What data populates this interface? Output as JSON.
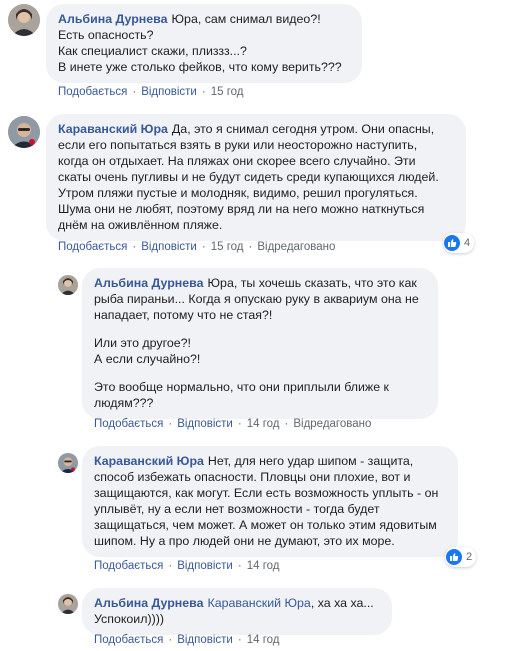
{
  "comments": [
    {
      "author": "Альбина Дурнева",
      "lines": [
        "Юра, сам снимал видео?!",
        "Есть опасность?",
        "Как специалист скажи, плиззз...?",
        "В инете уже столько фейков, что кому верить???"
      ],
      "actions": {
        "like": "Подобається",
        "reply": "Відповісти",
        "time": "15 год"
      }
    },
    {
      "author": "Караванский Юра",
      "lines": [
        "Да, это я снимал сегодня утром. Они опасны,",
        "если его попытаться взять в руки или неосторожно наступить,",
        "когда он отдыхает. На пляжах они скорее всего случайно. Эти",
        "скаты очень пугливы и не будут сидеть среди купающихся людей.",
        "Утром пляжи пустые и молодняк, видимо, решил прогуляться.",
        "Шума они не любят, поэтому вряд ли на него можно наткнуться",
        "днём на оживлённом пляже."
      ],
      "actions": {
        "like": "Подобається",
        "reply": "Відповісти",
        "time": "15 год",
        "edited": "Відредаговано"
      },
      "reactions": {
        "icon": "like-icon",
        "count": "4"
      }
    },
    {
      "author": "Альбина Дурнева",
      "lines": [
        "Юра, ты хочешь сказать, что это как",
        "рыба пираньи... Когда я опускаю руку в аквариум она не",
        "нападает, потому что не стая?!"
      ],
      "lines2": [
        "Или это другое?!",
        "А если случайно?!"
      ],
      "lines3": [
        "Это вообще нормально, что они приплыли ближе к",
        "людям???"
      ],
      "actions": {
        "like": "Подобається",
        "reply": "Відповісти",
        "time": "14 год",
        "edited": "Відредаговано"
      }
    },
    {
      "author": "Караванский Юра",
      "lines": [
        "Нет, для него удар шипом - защита,",
        "способ избежать опасности. Пловцы они плохие, вот и",
        "защищаются, как могут. Если есть возможность уплыть - он",
        "уплывёт, ну а если нет возможности - тогда будет",
        "защищаться, чем может. А может он только этим ядовитым",
        "шипом. Ну а про людей они не думают, это их море."
      ],
      "actions": {
        "like": "Подобається",
        "reply": "Відповісти",
        "time": "14 год"
      },
      "reactions": {
        "icon": "like-icon",
        "count": "2"
      }
    },
    {
      "author": "Альбина Дурнева",
      "mention": "Караванский Юра",
      "lines": [
        ", ха ха ха...",
        "Успокоил))))"
      ],
      "actions": {
        "like": "Подобається",
        "reply": "Відповісти",
        "time": "14 год"
      }
    }
  ],
  "colors": {
    "name": "#385898",
    "bubble": "#f0f2f5",
    "meta": "#606770",
    "like": "#1877f2"
  }
}
